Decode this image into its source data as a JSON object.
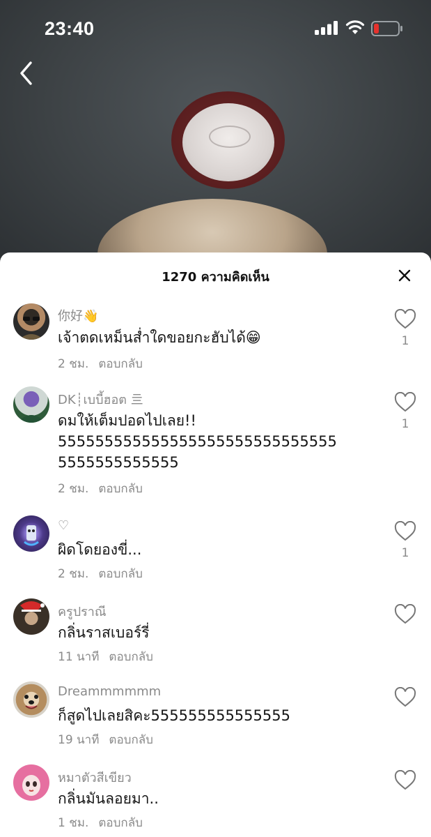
{
  "status_bar": {
    "time": "23:40"
  },
  "sheet": {
    "title": "1270 ความคิดเห็น"
  },
  "comments": [
    {
      "username": "你好👋",
      "text": "เจ้าตดเหม็นส่ำใดขอยกะฮับได้😁",
      "time": "2 ชม.",
      "reply": "ตอบกลับ",
      "likes": "1"
    },
    {
      "username": "DK┊เบบี้ฮอต 亖",
      "text": "ดมให้เต็มปอดไปเลย!!\n555555555555555555555555555555\n5555555555555",
      "time": "2 ชม.",
      "reply": "ตอบกลับ",
      "likes": "1"
    },
    {
      "username": "♡",
      "text": "ผิดโดยองขี่...",
      "time": "2 ชม.",
      "reply": "ตอบกลับ",
      "likes": "1"
    },
    {
      "username": "ครูปราณี",
      "text": "กลิ่นราสเบอร์รี่",
      "time": "11 นาที",
      "reply": "ตอบกลับ",
      "likes": ""
    },
    {
      "username": "Dreammmmmm",
      "text": "ก็สูดไปเลยสิคะ555555555555555",
      "time": "19 นาที",
      "reply": "ตอบกลับ",
      "likes": ""
    },
    {
      "username": "หมาตัวสีเขียว",
      "text": "กลิ่นมันลอยมา..",
      "time": "1 ชม.",
      "reply": "ตอบกลับ",
      "likes": ""
    }
  ],
  "colors": {
    "sheet_bg": "#ffffff",
    "muted": "#8a8a8a",
    "battery_low": "#e5322d"
  },
  "icons": [
    "signal-icon",
    "wifi-icon",
    "battery-icon",
    "back-chevron-icon",
    "close-icon",
    "heart-icon"
  ]
}
